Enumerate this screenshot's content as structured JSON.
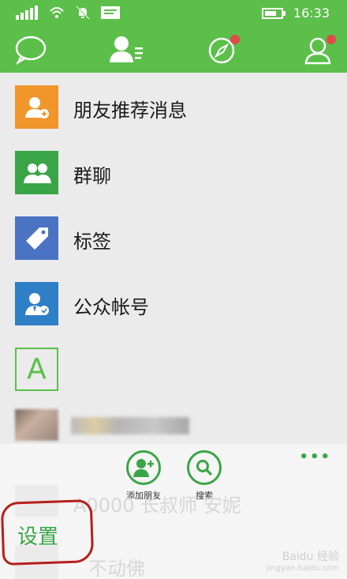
{
  "status": {
    "time": "16:33"
  },
  "tabs": [
    {
      "name": "chats"
    },
    {
      "name": "contacts"
    },
    {
      "name": "discover"
    },
    {
      "name": "me"
    }
  ],
  "menu_items": [
    {
      "label": "朋友推荐消息",
      "icon": "add-friend-icon",
      "color": "#f0962b"
    },
    {
      "label": "群聊",
      "icon": "group-icon",
      "color": "#3aa546"
    },
    {
      "label": "标签",
      "icon": "tag-icon",
      "color": "#4a73c4"
    },
    {
      "label": "公众帐号",
      "icon": "official-account-icon",
      "color": "#2e7fc6"
    }
  ],
  "index_letter": "A",
  "app_bar": {
    "add_friend": "添加朋友",
    "search": "搜索",
    "more": "•••",
    "settings": "设置"
  },
  "ghost": {
    "row1": "A0000  长叔师 安妮",
    "row2": "不动佛"
  },
  "watermark": {
    "line1": "Baidu 经验",
    "line2": "jingyan.baidu.com"
  },
  "colors": {
    "brand_green": "#5bbf4a",
    "accent_green": "#3aa546",
    "badge_red": "#e24a4a"
  }
}
